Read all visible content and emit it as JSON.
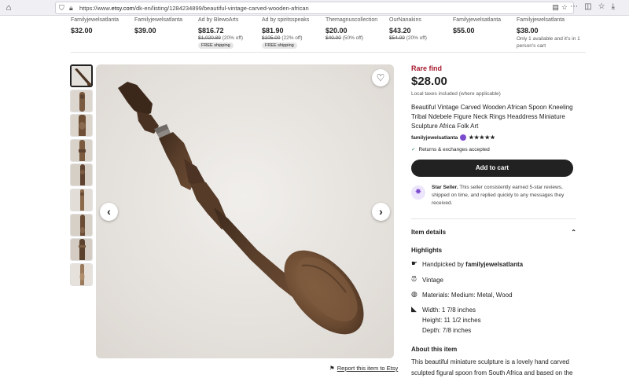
{
  "browser": {
    "url_prefix": "https://www.",
    "url_domain": "etsy.com",
    "url_path": "/dk-en/listing/1284234899/beautiful-vintage-carved-wooden-african"
  },
  "strip": [
    {
      "shop": "Familyjewelsatlanta",
      "price": "$32.00",
      "orig": "",
      "discount": "",
      "shipping": "",
      "note": ""
    },
    {
      "shop": "Familyjewelsatlanta",
      "price": "$39.00",
      "orig": "",
      "discount": "",
      "shipping": "",
      "note": ""
    },
    {
      "shop": "Ad by BlewoArts",
      "price": "$816.72",
      "orig": "$1,020.89",
      "discount": "(20% off)",
      "shipping": "FREE shipping",
      "note": ""
    },
    {
      "shop": "Ad by spiritsspeaks",
      "price": "$81.90",
      "orig": "$105.00",
      "discount": "(22% off)",
      "shipping": "FREE shipping",
      "note": ""
    },
    {
      "shop": "Themagnuscollection",
      "price": "$20.00",
      "orig": "$40.00",
      "discount": "(50% off)",
      "shipping": "",
      "note": ""
    },
    {
      "shop": "OurNanakins",
      "price": "$43.20",
      "orig": "$54.00",
      "discount": "(20% off)",
      "shipping": "",
      "note": ""
    },
    {
      "shop": "Familyjewelsatlanta",
      "price": "$55.00",
      "orig": "",
      "discount": "",
      "shipping": "",
      "note": ""
    },
    {
      "shop": "Familyjewelsatlanta",
      "price": "$38.00",
      "orig": "",
      "discount": "",
      "shipping": "",
      "note": "Only 1 available and it's in 1 person's cart"
    }
  ],
  "listing": {
    "rare": "Rare find",
    "price": "$28.00",
    "tax": "Local taxes included (where applicable)",
    "title": "Beautiful Vintage Carved Wooden African Spoon Kneeling Tribal Ndebele Figure Neck Rings Headdress Miniature Sculpture Africa Folk Art",
    "seller": "familyjewelsatlanta",
    "stars": "★★★★★",
    "returns": "Returns & exchanges accepted",
    "cart_label": "Add to cart",
    "star_seller_title": "Star Seller.",
    "star_seller_text": " This seller consistently earned 5-star reviews, shipped on time, and replied quickly to any messages they received.",
    "item_details": "Item details",
    "highlights_title": "Highlights",
    "handpicked_prefix": "Handpicked by ",
    "handpicked_shop": "familyjewelsatlanta",
    "vintage": "Vintage",
    "materials": "Materials: Medium: Metal, Wood",
    "width": "Width: 1 7/8 inches",
    "height": "Height: 11 1/2 inches",
    "depth": "Depth: 7/8 inches",
    "about_title": "About this item",
    "about_text": "This beautiful miniature sculpture is a lovely hand carved sculpted figural spoon from South Africa and based on the neck extender rings on her neck, it is a",
    "report": "Report this item to Etsy"
  },
  "colors": {
    "rare": "#a61a2e",
    "cart_bg": "#222222",
    "star_seller": "#7b4bce"
  }
}
